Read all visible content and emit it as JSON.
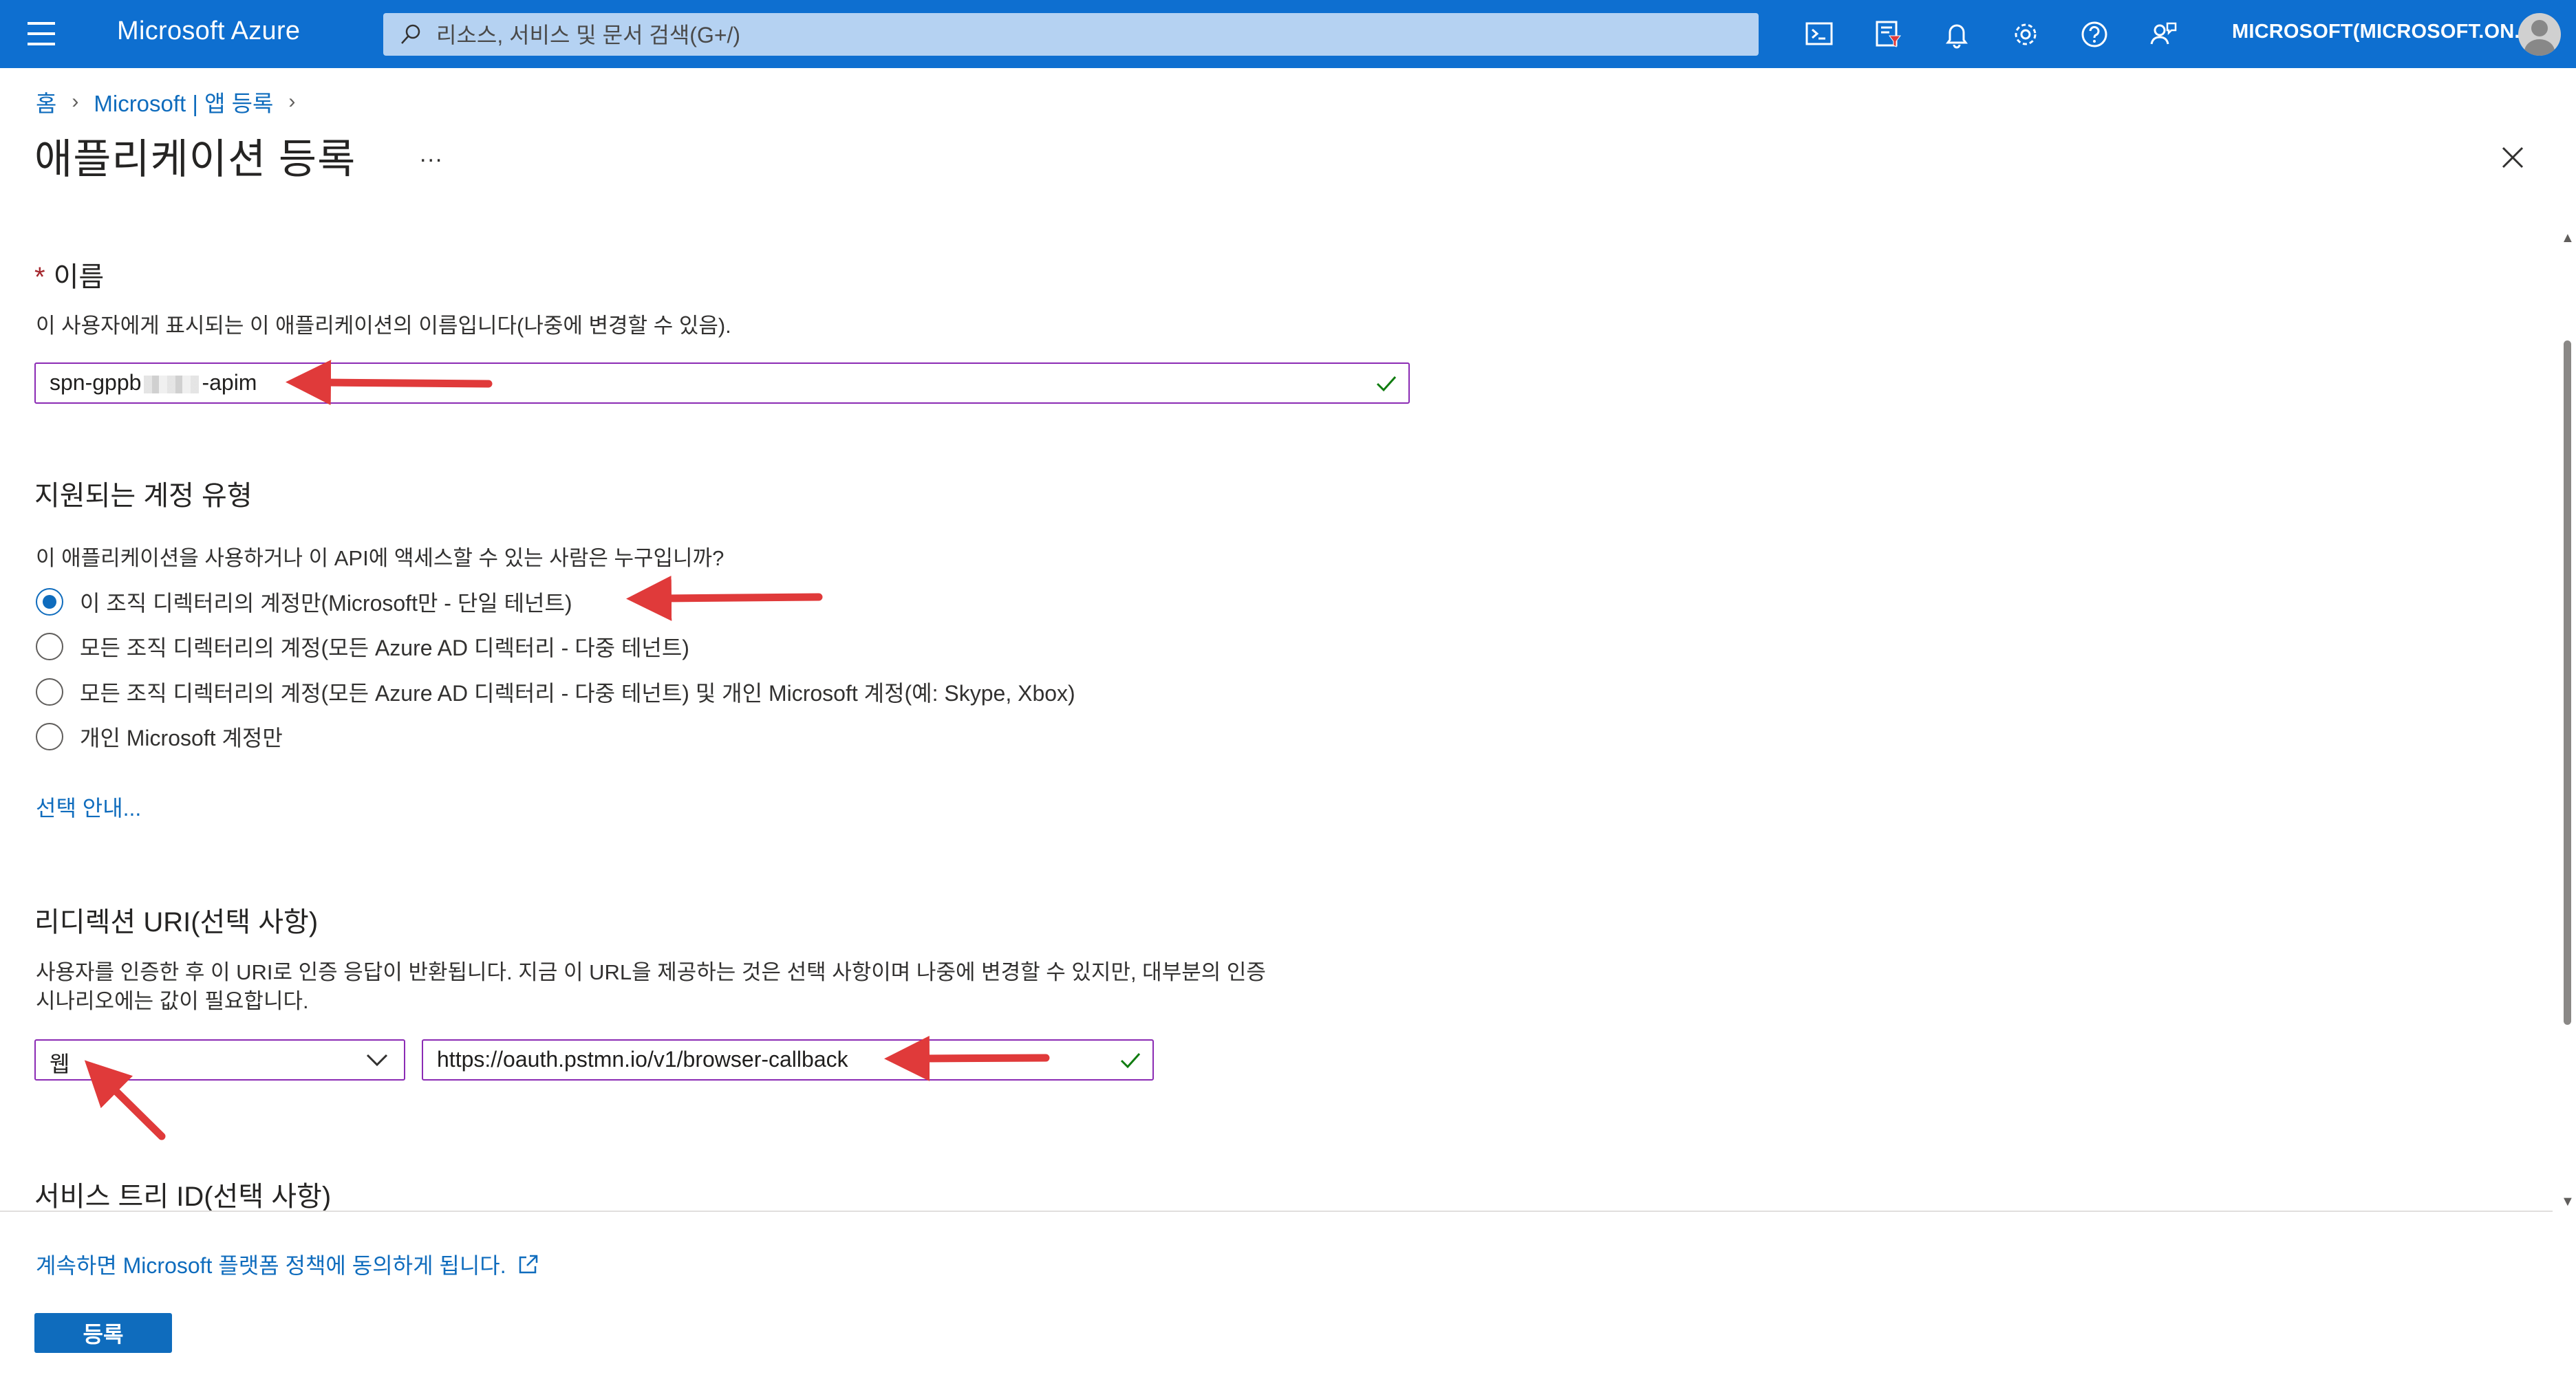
{
  "topbar": {
    "brand": "Microsoft Azure",
    "search_placeholder": "리소스, 서비스 및 문서 검색(G+/)",
    "account": "MICROSOFT(MICROSOFT.ON...",
    "icons": [
      "cloud-shell-icon",
      "directory-filter-icon",
      "bell-icon",
      "gear-icon",
      "help-icon",
      "feedback-icon"
    ]
  },
  "breadcrumb": {
    "home": "홈",
    "parent": "Microsoft | 앱 등록"
  },
  "page": {
    "title": "애플리케이션 등록",
    "more": "..."
  },
  "name_section": {
    "required_mark": "*",
    "label": "이름",
    "description": "이 사용자에게 표시되는 이 애플리케이션의 이름입니다(나중에 변경할 수 있음).",
    "value_prefix": "spn-gppb",
    "value_suffix": "-apim"
  },
  "account_types": {
    "heading": "지원되는 계정 유형",
    "question": "이 애플리케이션을 사용하거나 이 API에 액세스할 수 있는 사람은 누구입니까?",
    "options": [
      {
        "label": "이 조직 디렉터리의 계정만(Microsoft만 - 단일 테넌트)",
        "selected": true
      },
      {
        "label": "모든 조직 디렉터리의 계정(모든 Azure AD 디렉터리 - 다중 테넌트)",
        "selected": false
      },
      {
        "label": "모든 조직 디렉터리의 계정(모든 Azure AD 디렉터리 - 다중 테넌트) 및 개인 Microsoft 계정(예: Skype, Xbox)",
        "selected": false
      },
      {
        "label": "개인 Microsoft 계정만",
        "selected": false
      }
    ],
    "help_link": "선택 안내..."
  },
  "redirect": {
    "heading": "리디렉션 URI(선택 사항)",
    "description_line1": "사용자를 인증한 후 이 URI로 인증 응답이 반환됩니다. 지금 이 URL을 제공하는 것은 선택 사항이며 나중에 변경할 수 있지만, 대부분의 인증",
    "description_line2": "시나리오에는 값이 필요합니다.",
    "platform": "웹",
    "uri": "https://oauth.pstmn.io/v1/browser-callback"
  },
  "service_tree": {
    "heading": "서비스 트리 ID(선택 사항)"
  },
  "footer": {
    "policy_link": "계속하면 Microsoft 플랫폼 정책에 동의하게 됩니다.",
    "register_button": "등록"
  },
  "colors": {
    "topbar": "#0e6fd0",
    "accent": "#0f6cbd",
    "field_border": "#8b2bb4",
    "success": "#107c10",
    "annotation_arrow": "#e03a3a"
  }
}
